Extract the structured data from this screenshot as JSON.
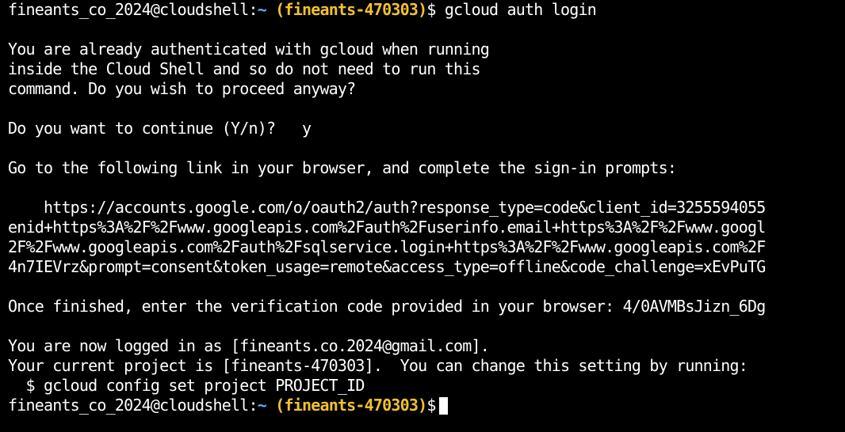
{
  "prompt": {
    "user_host": "fineants_co_2024@cloudshell:",
    "tilde": "~",
    "project": "(fineants-470303)",
    "dollar": "$"
  },
  "command1": " gcloud auth login",
  "message": {
    "line1": "You are already authenticated with gcloud when running",
    "line2": "inside the Cloud Shell and so do not need to run this",
    "line3": "command. Do you wish to proceed anyway?"
  },
  "continue_prompt": "Do you want to continue (Y/n)?   y",
  "goto_link": "Go to the following link in your browser, and complete the sign-in prompts:",
  "url_lines": {
    "l1": "    https://accounts.google.com/o/oauth2/auth?response_type=code&client_id=3255594055",
    "l2": "enid+https%3A%2F%2Fwww.googleapis.com%2Fauth%2Fuserinfo.email+https%3A%2F%2Fwww.googl",
    "l3": "2F%2Fwww.googleapis.com%2Fauth%2Fsqlservice.login+https%3A%2F%2Fwww.googleapis.com%2F",
    "l4": "4n7IEVrz&prompt=consent&token_usage=remote&access_type=offline&code_challenge=xEvPuTG"
  },
  "verification": "Once finished, enter the verification code provided in your browser: 4/0AVMBsJizn_6Dg",
  "logged_in": "You are now logged in as [fineants.co.2024@gmail.com].",
  "current_project": "Your current project is [fineants-470303].  You can change this setting by running:",
  "config_cmd": "  $ gcloud config set project PROJECT_ID",
  "colors": {
    "background": "#000000",
    "text": "#ffffff",
    "tilde": "#5ab0ff",
    "project": "#f2c12e"
  }
}
